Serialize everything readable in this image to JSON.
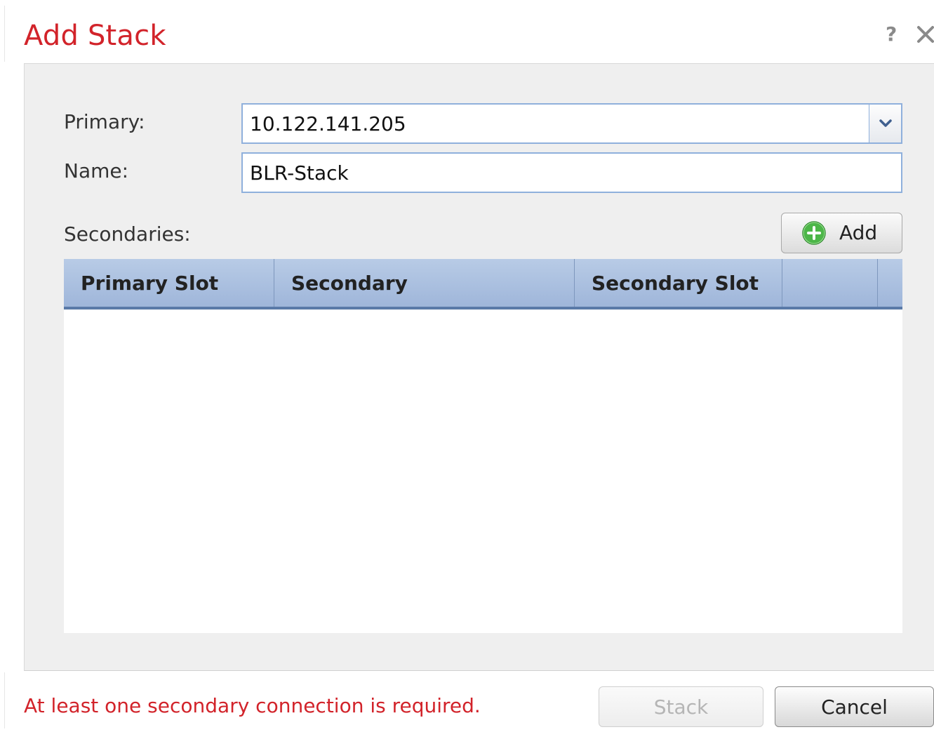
{
  "dialog": {
    "title": "Add Stack",
    "help_glyph": "?",
    "close_glyph": "×"
  },
  "form": {
    "primary_label": "Primary:",
    "primary_value": "10.122.141.205",
    "name_label": "Name:",
    "name_value": "BLR-Stack",
    "secondaries_label": "Secondaries:",
    "add_button_label": "Add"
  },
  "table": {
    "columns": [
      "Primary Slot",
      "Secondary",
      "Secondary Slot",
      ""
    ],
    "rows": []
  },
  "footer": {
    "error_message": "At least one secondary connection is required.",
    "stack_button_label": "Stack",
    "cancel_button_label": "Cancel"
  },
  "colors": {
    "title_red": "#d2232a",
    "header_blue": "#a9bfe0",
    "add_icon_green": "#4cb648"
  },
  "icons": {
    "help": "help-icon",
    "close": "close-icon",
    "dropdown": "chevron-down-icon",
    "add": "plus-circle-icon"
  }
}
